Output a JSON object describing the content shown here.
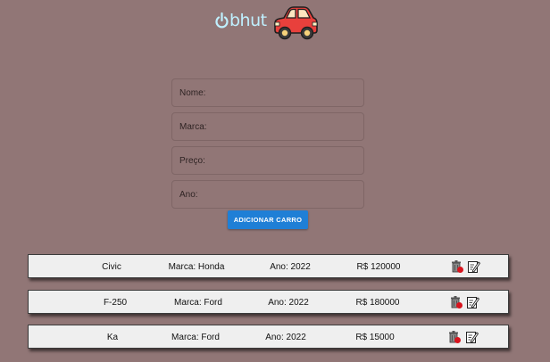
{
  "header": {
    "logo_text": "bhut",
    "logo_icon": "power-icon",
    "car_icon": "red-car-icon"
  },
  "form": {
    "name_placeholder": "Nome:",
    "brand_placeholder": "Marca:",
    "price_placeholder": "Preço:",
    "year_placeholder": "Ano:",
    "add_button_label": "ADICIONAR CARRO"
  },
  "cars": [
    {
      "name": "Civic",
      "brand": "Marca: Honda",
      "year": "Ano: 2022",
      "price": "R$ 120000"
    },
    {
      "name": "F-250",
      "brand": "Marca: Ford",
      "year": "Ano: 2022",
      "price": "R$ 180000"
    },
    {
      "name": "Ka",
      "brand": "Marca: Ford",
      "year": "Ano: 2022",
      "price": "R$ 15000"
    }
  ],
  "actions": {
    "delete_icon": "trash-icon",
    "edit_icon": "edit-icon"
  },
  "colors": {
    "background": "#917676",
    "button": "#1f7fd6",
    "logo": "#bff0ff",
    "car": "#e8403c"
  }
}
